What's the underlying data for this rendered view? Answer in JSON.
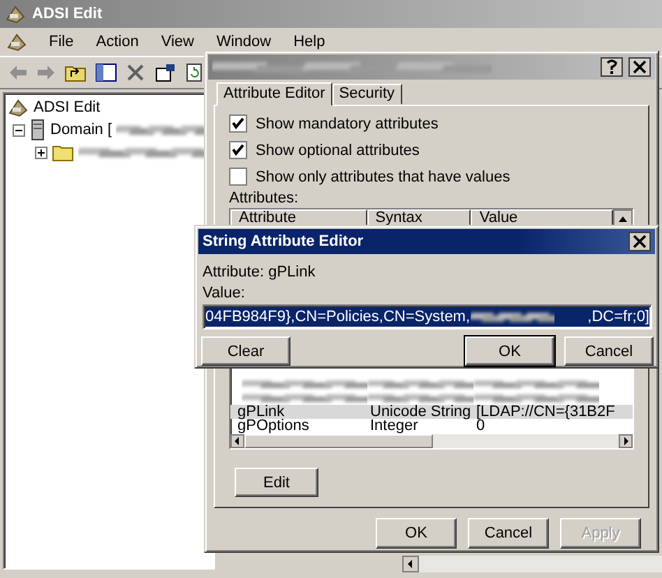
{
  "window": {
    "title": "ADSI Edit",
    "active": false
  },
  "menu": [
    {
      "label": "File"
    },
    {
      "label": "Action"
    },
    {
      "label": "View"
    },
    {
      "label": "Window"
    },
    {
      "label": "Help"
    }
  ],
  "tree": [
    {
      "label": "ADSI Edit",
      "children": [
        {
          "label": "Domain [",
          "expanded": true,
          "children": [
            {
              "expanded": false
            }
          ]
        }
      ]
    }
  ],
  "properties_dialog": {
    "tabs": [
      {
        "label": "Attribute Editor",
        "selected": true
      },
      {
        "label": "Security",
        "selected": false
      }
    ],
    "checkboxes": [
      {
        "label": "Show mandatory attributes",
        "checked": true
      },
      {
        "label": "Show optional attributes",
        "checked": true
      },
      {
        "label": "Show only attributes that have values",
        "checked": false
      }
    ],
    "attributes_label": "Attributes:",
    "columns": [
      "Attribute",
      "Syntax",
      "Value"
    ],
    "rows": [
      {
        "attribute": "gPLink",
        "syntax": "Unicode String",
        "value": "[LDAP://CN={31B2F",
        "selected": true
      },
      {
        "attribute": "gPOptions",
        "syntax": "Integer",
        "value": "0",
        "selected": false
      }
    ],
    "edit_button": "Edit",
    "buttons": [
      {
        "label": "OK",
        "disabled": false
      },
      {
        "label": "Cancel",
        "disabled": false
      },
      {
        "label": "Apply",
        "disabled": true
      }
    ]
  },
  "string_editor": {
    "title": "String Attribute Editor",
    "attribute": "Attribute: gPLink",
    "value_label": "Value:",
    "value_start": "04FB984F9},CN=Policies,CN=System,",
    "value_end": ",DC=fr;0]",
    "buttons": [
      {
        "label": "Clear",
        "default": false
      },
      {
        "label": "OK",
        "default": true
      },
      {
        "label": "Cancel",
        "default": false
      }
    ]
  }
}
